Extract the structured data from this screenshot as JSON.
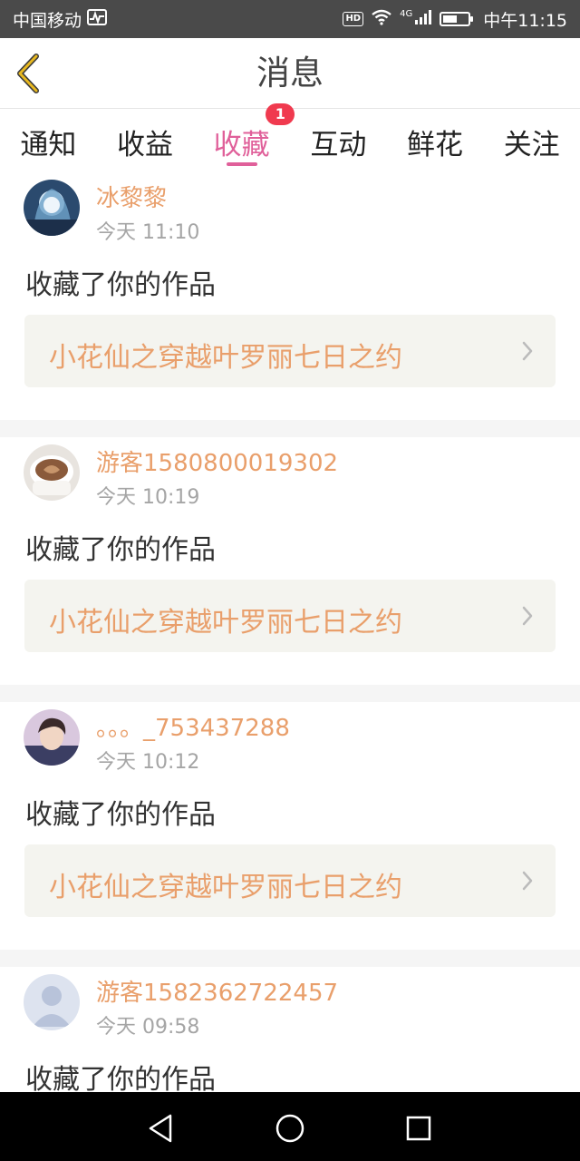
{
  "status_bar": {
    "carrier": "中国移动",
    "hd": "HD",
    "network": "4G",
    "time": "中午11:15",
    "battery_level": 0.55
  },
  "header": {
    "title": "消息",
    "back_icon": "chevron-left-icon"
  },
  "tabs": [
    {
      "label": "通知"
    },
    {
      "label": "收益"
    },
    {
      "label": "收藏",
      "badge": "1",
      "active": true
    },
    {
      "label": "互动"
    },
    {
      "label": "鲜花"
    },
    {
      "label": "关注"
    }
  ],
  "messages": [
    {
      "username": "冰黎黎",
      "time": "今天 11:10",
      "action": "收藏了你的作品",
      "work_title": "小花仙之穿越叶罗丽七日之约"
    },
    {
      "username": "游客1580800019302",
      "time": "今天 10:19",
      "action": "收藏了你的作品",
      "work_title": "小花仙之穿越叶罗丽七日之约"
    },
    {
      "username": "。。。_753437288",
      "time": "今天 10:12",
      "action": "收藏了你的作品",
      "work_title": "小花仙之穿越叶罗丽七日之约"
    },
    {
      "username": "游客1582362722457",
      "time": "今天 09:58",
      "action": "收藏了你的作品",
      "work_title": ""
    }
  ],
  "colors": {
    "accent": "#e0609a",
    "name_color": "#e99f6b",
    "badge": "#f03a4f",
    "back_icon": "#e8b820"
  }
}
